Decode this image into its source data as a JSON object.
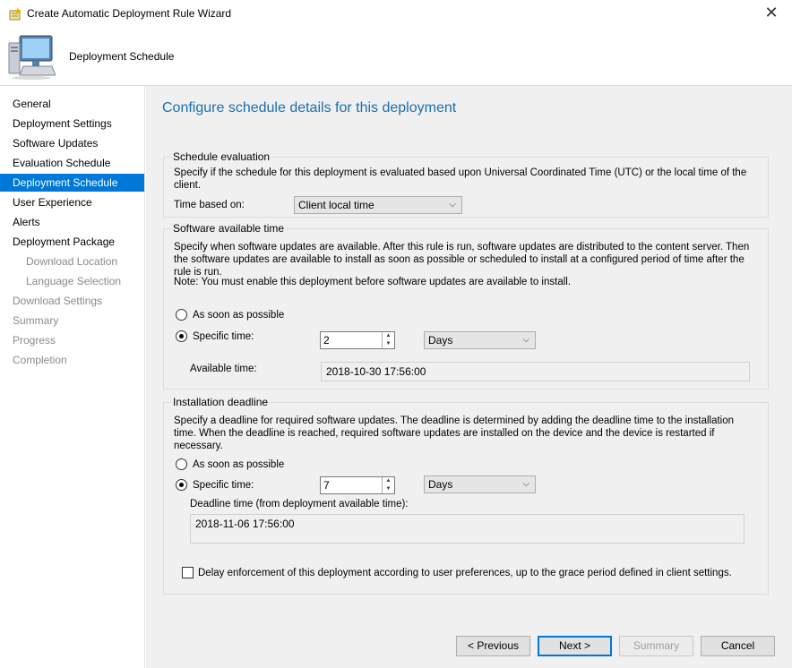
{
  "window": {
    "title": "Create Automatic Deployment Rule Wizard",
    "close_glyph": "✕"
  },
  "header": {
    "title": "Deployment Schedule"
  },
  "nav": {
    "items": [
      {
        "label": "General"
      },
      {
        "label": "Deployment Settings"
      },
      {
        "label": "Software Updates"
      },
      {
        "label": "Evaluation Schedule"
      },
      {
        "label": "Deployment Schedule"
      },
      {
        "label": "User Experience"
      },
      {
        "label": "Alerts"
      },
      {
        "label": "Deployment Package"
      },
      {
        "label": "Download Location"
      },
      {
        "label": "Language Selection"
      },
      {
        "label": "Download Settings"
      },
      {
        "label": "Summary"
      },
      {
        "label": "Progress"
      },
      {
        "label": "Completion"
      }
    ]
  },
  "main": {
    "title": "Configure schedule details for this deployment",
    "schedule_evaluation": {
      "label": "Schedule evaluation",
      "description": "Specify if the schedule for this deployment is evaluated based upon Universal Coordinated Time (UTC) or the local time of the client.",
      "time_based_label": "Time based on:",
      "time_based_value": "Client local time"
    },
    "available_time": {
      "label": "Software available time",
      "description": "Specify when software updates are available. After this rule is run, software updates are distributed to the content server. Then the software updates are available to install as soon as possible or scheduled to install at a configured period of time after the rule is run.",
      "note": "Note: You must enable this deployment before software updates are available to install.",
      "asap_label": "As soon as possible",
      "specific_label": "Specific time:",
      "specific_value": "2",
      "unit_value": "Days",
      "available_time_label": "Available time:",
      "available_time_value": "2018-10-30 17:56:00"
    },
    "deadline": {
      "label": "Installation deadline",
      "description": "Specify a deadline for required software updates. The deadline is determined by adding the deadline time to the installation time. When the deadline is reached, required software updates are installed on the device and the device is restarted if necessary.",
      "asap_label": "As soon as possible",
      "specific_label": "Specific time:",
      "specific_value": "7",
      "unit_value": "Days",
      "deadline_time_label": "Deadline time (from deployment available time):",
      "deadline_time_value": "2018-11-06 17:56:00",
      "delay_label": "Delay enforcement of this deployment according to user preferences, up to the grace period defined in client settings."
    }
  },
  "buttons": {
    "previous": "< Previous",
    "next": "Next >",
    "summary": "Summary",
    "cancel": "Cancel"
  },
  "colors": {
    "accent": "#0078d7",
    "title_blue": "#1a6fb0"
  }
}
